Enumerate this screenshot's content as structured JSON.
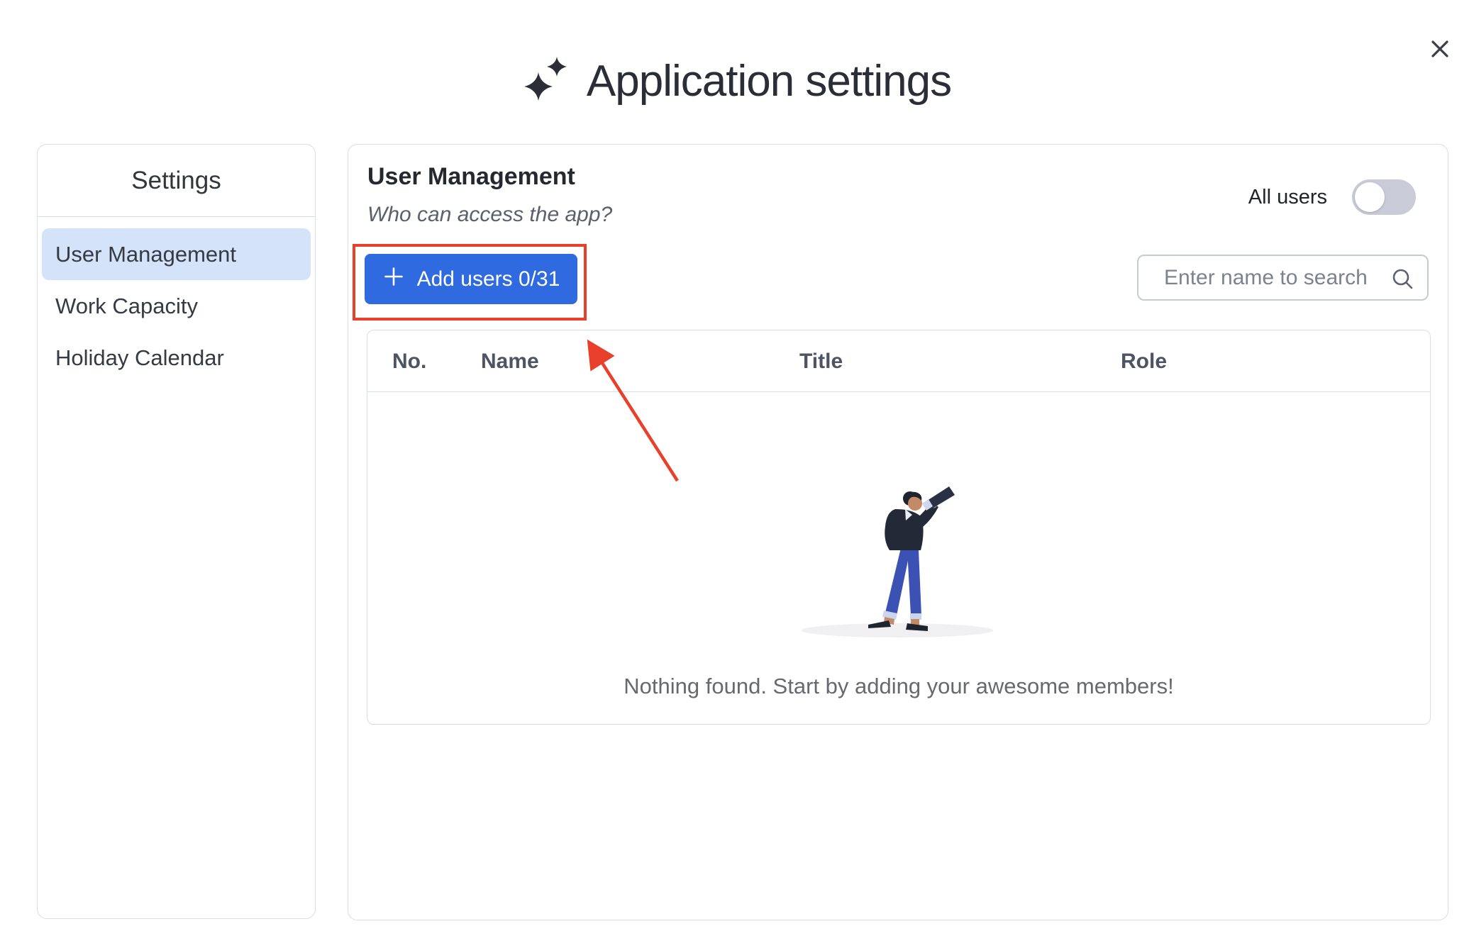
{
  "window": {
    "title": "Application settings",
    "title_icon": "sparkles-icon",
    "close_icon": "close-x"
  },
  "sidebar": {
    "title": "Settings",
    "items": [
      {
        "label": "User Management",
        "selected": true
      },
      {
        "label": "Work Capacity",
        "selected": false
      },
      {
        "label": "Holiday Calendar",
        "selected": false
      }
    ]
  },
  "panel": {
    "heading": "User Management",
    "subtitle": "Who can access the app?",
    "all_users": {
      "label": "All users",
      "toggle_state": "off"
    },
    "add_users_button": {
      "label": "Add users 0/31",
      "icon": "plus-icon"
    },
    "search": {
      "placeholder": "Enter name to search",
      "icon": "search-icon"
    },
    "table": {
      "columns": [
        "No.",
        "Name",
        "Title",
        "Role"
      ],
      "rows": []
    },
    "empty_state": {
      "message": "Nothing found. Start by adding your awesome members!",
      "illustration": "person-with-spyglass"
    }
  },
  "annotations": {
    "highlight_box_target": "add-users-button",
    "arrow_target": "add-users-button",
    "color": "#e8402a"
  },
  "colors": {
    "accent_blue": "#2f6ae0",
    "selected_item_bg": "#d4e3fa",
    "annotation_red": "#e8402a",
    "card_border": "#d9dde9",
    "toggle_track_off": "#c9ccd8"
  }
}
